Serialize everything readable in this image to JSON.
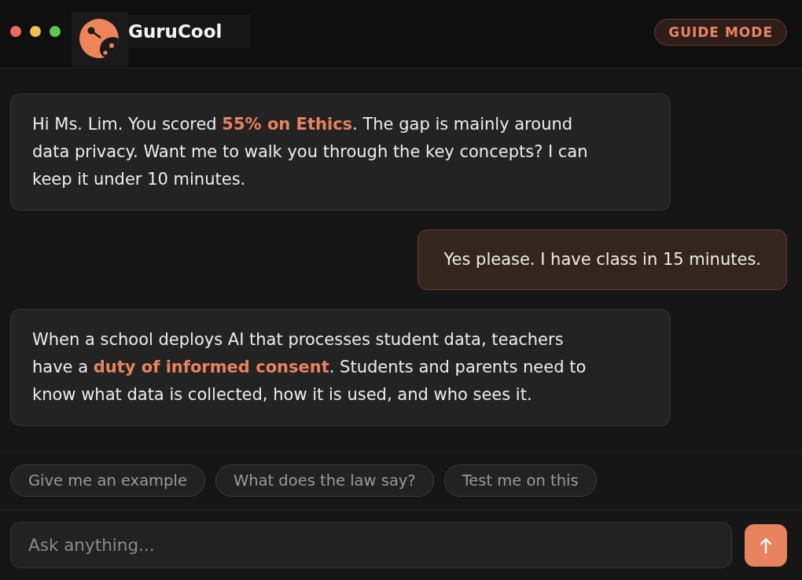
{
  "header": {
    "app_name": "GuruCool",
    "mode_badge": "GUIDE MODE"
  },
  "messages": [
    {
      "kind": "assistant",
      "text": "Hi Ms. Lim. You scored **55% on Ethics**. The gap is mainly around data privacy. Want me to walk you through the key concepts? I can keep it under 10 minutes."
    },
    {
      "kind": "user",
      "text": "Yes please. I have class in 15 minutes."
    },
    {
      "kind": "assistant",
      "text": "When a school deploys AI that processes student data, teachers have a **duty of informed consent**. Students and parents need to know what data is collected, how it is used, and who sees it."
    }
  ],
  "suggestions": [
    "Give me an example",
    "What does the law say?",
    "Test me on this"
  ],
  "composer": {
    "placeholder": "Ask anything..."
  }
}
